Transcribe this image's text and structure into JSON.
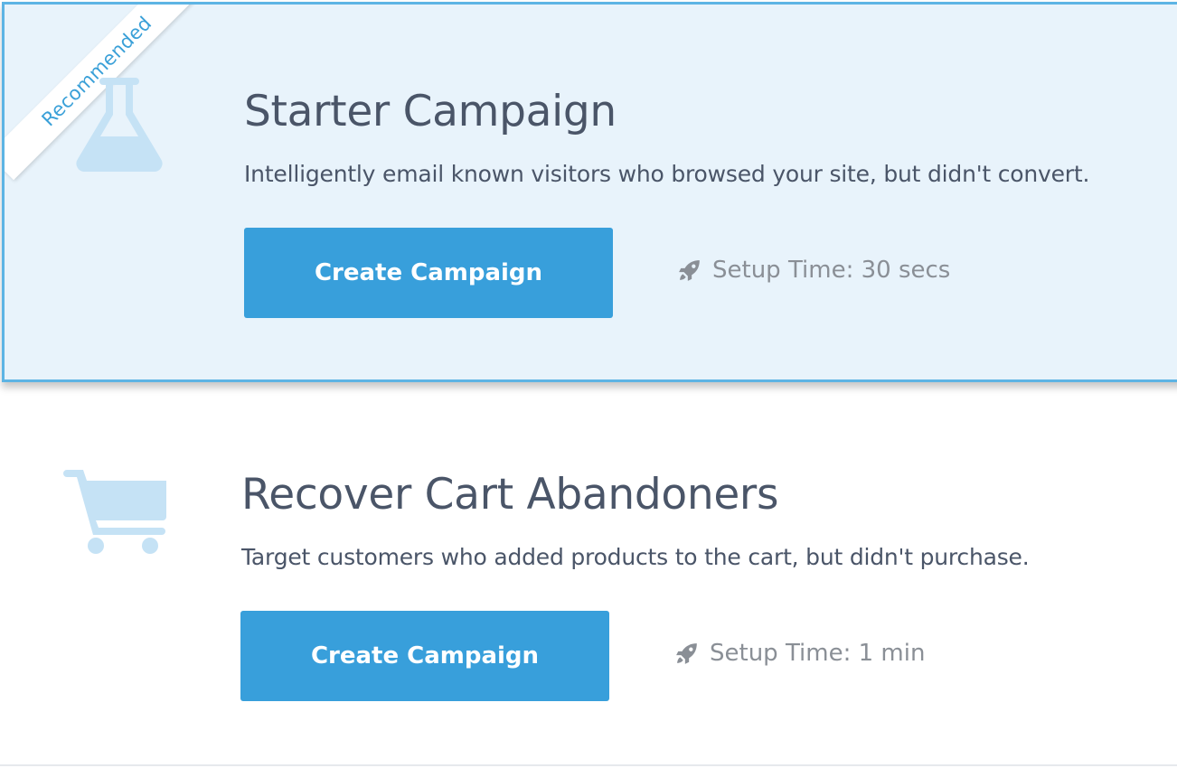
{
  "campaigns": [
    {
      "badge": "Recommended",
      "icon": "flask-icon",
      "title": "Starter Campaign",
      "description": "Intelligently email known visitors who browsed your site, but didn't convert.",
      "button_label": "Create Campaign",
      "setup_time": "Setup Time: 30 secs"
    },
    {
      "icon": "cart-icon",
      "title": "Recover Cart Abandoners",
      "description": "Target customers who added products to the cart, but didn't purchase.",
      "button_label": "Create Campaign",
      "setup_time": "Setup Time: 1 min"
    }
  ],
  "colors": {
    "accent": "#389fdb",
    "highlight_bg": "#e8f3fb",
    "highlight_border": "#5db4e4",
    "icon_light": "#c5e2f5",
    "text_primary": "#4a5568",
    "text_muted": "#8a8f96"
  }
}
